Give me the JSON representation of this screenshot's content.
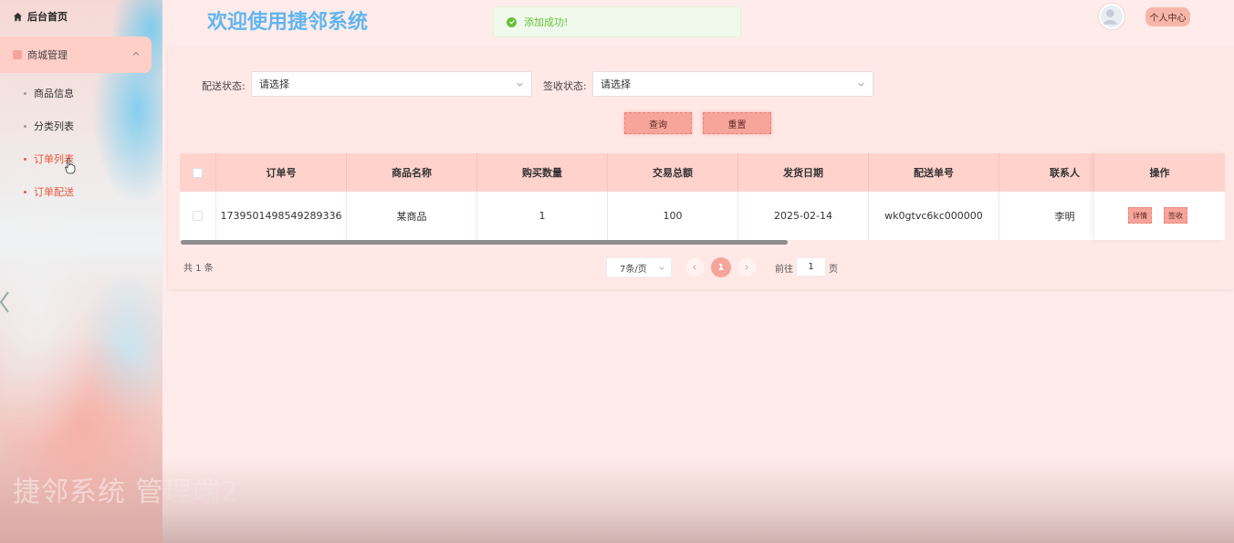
{
  "sidebar": {
    "home": "后台首页",
    "group": "商城管理",
    "items": [
      {
        "label": "商品信息"
      },
      {
        "label": "分类列表"
      },
      {
        "label": "订单列表"
      },
      {
        "label": "订单配送"
      }
    ],
    "watermark": "捷邻系统 管理端2"
  },
  "header": {
    "title": "欢迎使用捷邻系统",
    "toast": "添加成功!",
    "profile_button": "个人中心"
  },
  "filters": {
    "delivery_label": "配送状态:",
    "delivery_placeholder": "请选择",
    "receipt_label": "签收状态:",
    "receipt_placeholder": "请选择",
    "search_button": "查询",
    "reset_button": "重置"
  },
  "table": {
    "columns": [
      "订单号",
      "商品名称",
      "购买数量",
      "交易总额",
      "发货日期",
      "配送单号",
      "联系人"
    ],
    "operation_header": "操作",
    "rows": [
      {
        "order_no": "1739501498549289336",
        "product": "某商品",
        "quantity": "1",
        "total": "100",
        "ship_date": "2025-02-14",
        "delivery_no": "wk0gtvc6kc000000",
        "contact": "李明",
        "detail_button": "详情",
        "sign_button": "签收"
      }
    ]
  },
  "pagination": {
    "total": "共 1 条",
    "page_size": "7条/页",
    "current_page": "1",
    "goto_label": "前往",
    "goto_value": "1",
    "page_suffix": "页"
  },
  "colors": {
    "accent": "#f7a49b",
    "title": "#61b5ef",
    "active_menu": "#e8573f",
    "success": "#67c23a"
  }
}
